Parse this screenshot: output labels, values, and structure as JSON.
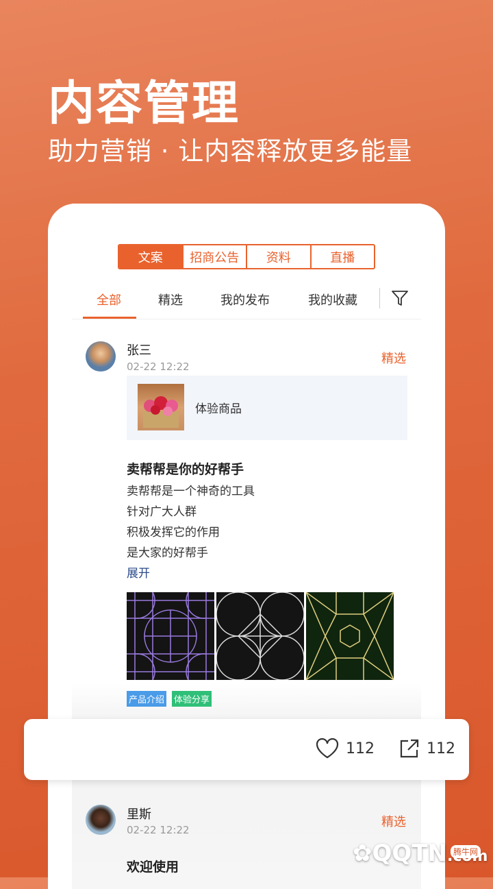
{
  "header": {
    "title": "内容管理",
    "subtitle": "助力营销 · 让内容释放更多能量"
  },
  "segments": [
    "文案",
    "招商公告",
    "资料",
    "直播"
  ],
  "tabs": [
    "全部",
    "精选",
    "我的发布",
    "我的收藏"
  ],
  "filter_icon": "filter-icon",
  "posts": [
    {
      "author": "张三",
      "time": "02-22 12:22",
      "badge": "精选",
      "product": "体验商品",
      "title": "卖帮帮是你的好帮手",
      "lines": [
        "卖帮帮是一个神奇的工具",
        "针对广大人群",
        "积极发挥它的作用",
        "是大家的好帮手"
      ],
      "expand": "展开",
      "tags": [
        {
          "label": "产品介绍",
          "color": "#4a9be8"
        },
        {
          "label": "体验分享",
          "color": "#2fbf78"
        }
      ]
    },
    {
      "author": "里斯",
      "time": "02-22 12:22",
      "badge": "精选",
      "title": "欢迎使用"
    }
  ],
  "actions": {
    "likes": "112",
    "shares": "112"
  },
  "watermark": {
    "text": "QQTN",
    "suffix": ".com",
    "tag": "腾牛网"
  },
  "colors": {
    "accent": "#e9622d"
  }
}
